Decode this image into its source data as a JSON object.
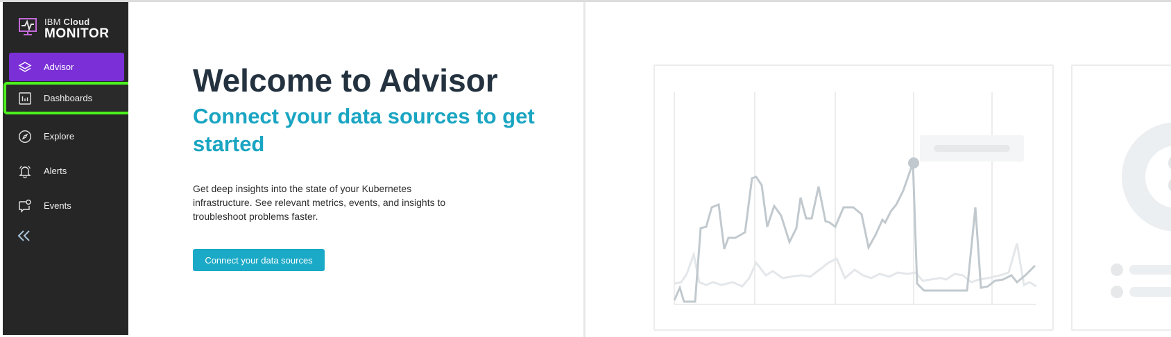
{
  "app": {
    "brand_small_prefix": "IBM ",
    "brand_small_bold": "Cloud",
    "brand_big": "MONITOR"
  },
  "sidebar": {
    "items": [
      {
        "label": "Advisor",
        "icon": "advisor-layers-icon",
        "active": true
      },
      {
        "label": "Dashboards",
        "icon": "dashboards-bar-chart-icon",
        "active": false,
        "highlighted": true
      },
      {
        "label": "Explore",
        "icon": "explore-compass-icon",
        "active": false
      },
      {
        "label": "Alerts",
        "icon": "alerts-bell-icon",
        "active": false
      },
      {
        "label": "Events",
        "icon": "events-chat-icon",
        "active": false
      }
    ],
    "collapse_icon": "double-chevron-left-icon"
  },
  "main": {
    "title": "Welcome to Advisor",
    "subtitle": "Connect your data sources to get started",
    "description": "Get deep insights into the state of your Kubernetes infrastructure. See relevant metrics, events, and insights to troubleshoot problems faster.",
    "cta_label": "Connect your data sources"
  },
  "colors": {
    "sidebar_bg": "#262626",
    "active_nav": "#7a30d6",
    "highlight_outline": "#4cf01e",
    "accent": "#1aa9c6",
    "title": "#243240"
  }
}
